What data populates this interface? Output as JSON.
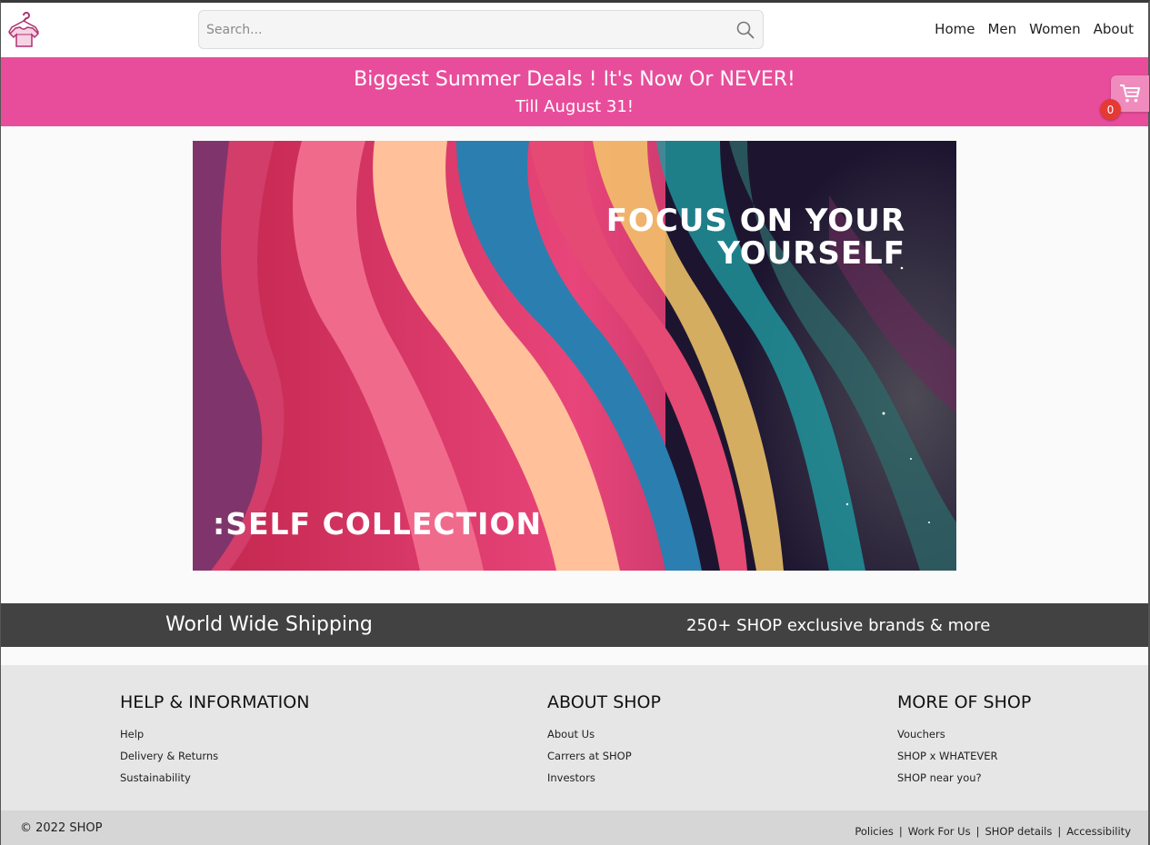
{
  "header": {
    "search": {
      "placeholder": "Search...",
      "value": ""
    },
    "nav": [
      "Home",
      "Men",
      "Women",
      "About"
    ]
  },
  "promo": {
    "title": "Biggest Summer Deals ! It's Now Or NEVER!",
    "subtitle": "Till August 31!",
    "color": "#e84d9b"
  },
  "cart": {
    "count": "0"
  },
  "hero": {
    "headline_line1": "FOCUS ON YOUR",
    "headline_line2": "YOURSELF",
    "collection": ":SELF COLLECTION"
  },
  "features": {
    "left": "World Wide Shipping",
    "right": "250+ SHOP exclusive brands & more"
  },
  "footer": {
    "columns": [
      {
        "title": "HELP & INFORMATION",
        "links": [
          "Help",
          "Delivery & Returns",
          "Sustainability"
        ]
      },
      {
        "title": "ABOUT SHOP",
        "links": [
          "About Us",
          "Carrers at SHOP",
          "Investors"
        ]
      },
      {
        "title": "MORE OF SHOP",
        "links": [
          "Vouchers",
          "SHOP x WHATEVER",
          "SHOP near you?"
        ]
      }
    ],
    "copyright": "© 2022 SHOP",
    "bottom_links": [
      "Policies",
      "Work For Us",
      "SHOP details",
      "Accessibility"
    ],
    "separator": "|"
  },
  "icons": {
    "logo": "tshirt-hanger-icon",
    "search": "search-icon",
    "cart": "cart-icon"
  }
}
